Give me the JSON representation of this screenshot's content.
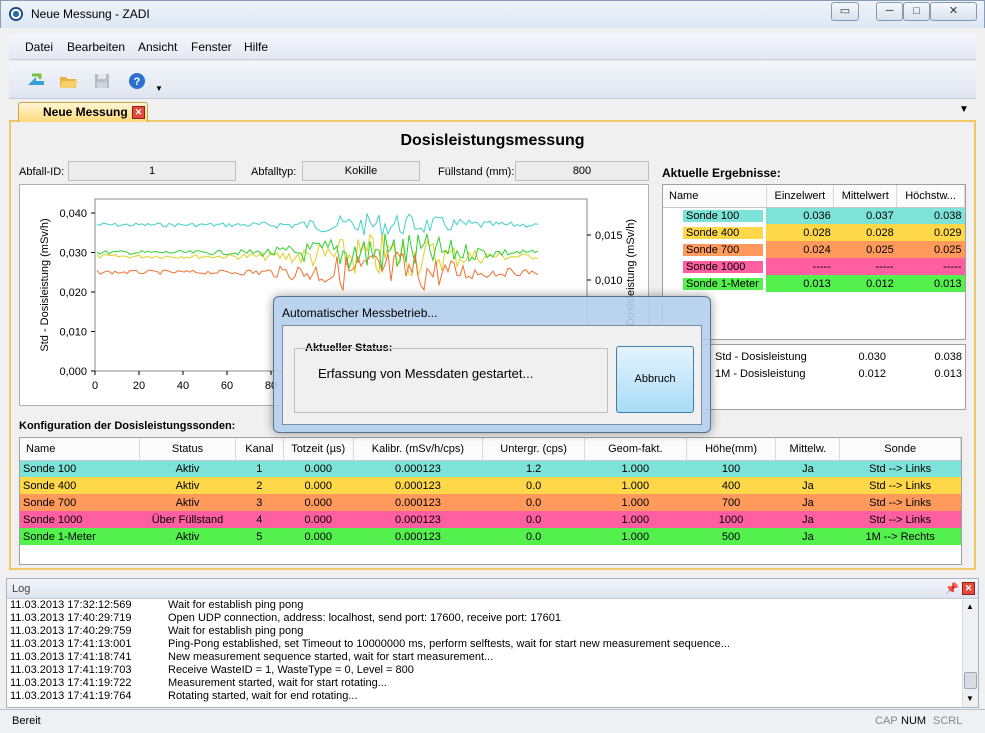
{
  "window": {
    "title": "Neue Messung - ZADI"
  },
  "menu": [
    "Datei",
    "Bearbeiten",
    "Ansicht",
    "Fenster",
    "Hilfe"
  ],
  "tab": {
    "label": "Neue Messung"
  },
  "header": {
    "title": "Dosisleistungsmessung"
  },
  "fields": {
    "abfall_id_label": "Abfall-ID:",
    "abfall_id": "1",
    "abfalltyp_label": "Abfalltyp:",
    "abfalltyp": "Kokille",
    "fuellstand_label": "Füllstand (mm):",
    "fuellstand": "800"
  },
  "chart_data": {
    "type": "line",
    "ylabel": "Std - Dosisleistung (mSv/h)",
    "ylabel_right": "1M - Dosisleistung (mSv/h)",
    "ylim": [
      0,
      0.04
    ],
    "yticks": [
      "0,040",
      "0,030",
      "0,020",
      "0,010",
      "0,000"
    ],
    "xticks": [
      "0",
      "20",
      "40",
      "60",
      "80"
    ],
    "yticks_right": [
      "0,015",
      "0,010"
    ],
    "series": [
      {
        "color": "#40d0c8",
        "level": 0.037
      },
      {
        "color": "#e0d020",
        "level": 0.029
      },
      {
        "color": "#30d030",
        "level": 0.03
      },
      {
        "color": "#f07030",
        "level": 0.025
      }
    ]
  },
  "results": {
    "title": "Aktuelle Ergebnisse:",
    "headers": [
      "Name",
      "Einzelwert",
      "Mittelwert",
      "Höchstw..."
    ],
    "rows": [
      {
        "name": "Sonde 100",
        "einzel": "0.036",
        "mittel": "0.037",
        "hoechst": "0.038",
        "color": "#7de3d8"
      },
      {
        "name": "Sonde 400",
        "einzel": "0.028",
        "mittel": "0.028",
        "hoechst": "0.029",
        "color": "#ffd84a"
      },
      {
        "name": "Sonde 700",
        "einzel": "0.024",
        "mittel": "0.025",
        "hoechst": "0.025",
        "color": "#ff9a5c"
      },
      {
        "name": "Sonde 1000",
        "einzel": "-----",
        "mittel": "-----",
        "hoechst": "-----",
        "color": "#ff5fa0"
      },
      {
        "name": "Sonde 1-Meter",
        "einzel": "0.013",
        "mittel": "0.012",
        "hoechst": "0.013",
        "color": "#54f04e"
      }
    ],
    "summary": [
      {
        "name": "Std - Dosisleistung",
        "mittel": "0.030",
        "hoechst": "0.038"
      },
      {
        "name": "1M - Dosisleistung",
        "mittel": "0.012",
        "hoechst": "0.013"
      }
    ]
  },
  "config": {
    "title": "Konfiguration der Dosisleistungssonden:",
    "headers": [
      "Name",
      "Status",
      "Kanal",
      "Totzeit (µs)",
      "Kalibr. (mSv/h/cps)",
      "Untergr. (cps)",
      "Geom-fakt.",
      "Höhe(mm)",
      "Mittelw.",
      "Sonde"
    ],
    "rows": [
      [
        "Sonde 100",
        "Aktiv",
        "1",
        "0.000",
        "0.000123",
        "1.2",
        "1.000",
        "100",
        "Ja",
        "Std --> Links"
      ],
      [
        "Sonde 400",
        "Aktiv",
        "2",
        "0.000",
        "0.000123",
        "0.0",
        "1.000",
        "400",
        "Ja",
        "Std --> Links"
      ],
      [
        "Sonde 700",
        "Aktiv",
        "3",
        "0.000",
        "0.000123",
        "0.0",
        "1.000",
        "700",
        "Ja",
        "Std --> Links"
      ],
      [
        "Sonde 1000",
        "Über Füllstand",
        "4",
        "0.000",
        "0.000123",
        "0.0",
        "1.000",
        "1000",
        "Ja",
        "Std --> Links"
      ],
      [
        "Sonde 1-Meter",
        "Aktiv",
        "5",
        "0.000",
        "0.000123",
        "0.0",
        "1.000",
        "500",
        "Ja",
        "1M --> Rechts"
      ]
    ]
  },
  "dialog": {
    "title": "Automatischer Messbetrieb...",
    "group": "Aktueller Status:",
    "message": "Erfassung von Messdaten gestartet...",
    "button": "Abbruch"
  },
  "log": {
    "title": "Log",
    "rows": [
      [
        "11.03.2013 17:32:12:569",
        "Wait for establish ping pong"
      ],
      [
        "11.03.2013 17:40:29:719",
        "Open UDP connection, address: localhost, send port: 17600, receive port: 17601"
      ],
      [
        "11.03.2013 17:40:29:759",
        "Wait for establish ping pong"
      ],
      [
        "11.03.2013 17:41:13:001",
        "Ping-Pong established, set Timeout to 10000000 ms, perform selftests, wait for start new measurement sequence..."
      ],
      [
        "11.03.2013 17:41:18:741",
        "New measurement sequence started, wait for start measurement..."
      ],
      [
        "11.03.2013 17:41:19:703",
        "Receive WasteID = 1, WasteType = 0, Level = 800"
      ],
      [
        "11.03.2013 17:41:19:722",
        "Measurement started, wait for start rotating..."
      ],
      [
        "11.03.2013 17:41:19:764",
        "Rotating started, wait for end rotating..."
      ]
    ]
  },
  "statusbar": {
    "text": "Bereit",
    "cap": "CAP",
    "num": "NUM",
    "scrl": "SCRL"
  }
}
